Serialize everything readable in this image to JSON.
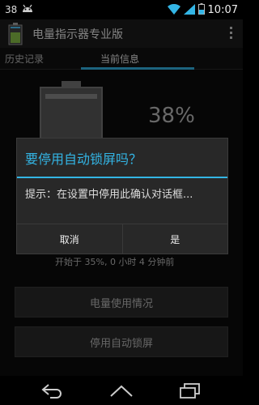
{
  "status_bar": {
    "battery_level_text": "38",
    "time": "10:07",
    "icons": [
      "android-debug-icon",
      "wifi-icon",
      "cell-signal-icon",
      "battery-icon"
    ]
  },
  "app": {
    "title": "电量指示器专业版"
  },
  "tabs": [
    {
      "label": "历史记录",
      "active": false
    },
    {
      "label": "当前信息",
      "active": true
    }
  ],
  "battery": {
    "percent_text": "38%",
    "level": 0.38
  },
  "info": {
    "since_text": "开始于 35%, 0 小时 4 分钟前"
  },
  "buttons": {
    "usage_label": "电量使用情况",
    "disable_lock_label": "停用自动锁屏"
  },
  "dialog": {
    "title": "要停用自动锁屏吗？",
    "message": "提示：在设置中停用此确认对话框...",
    "cancel_label": "取消",
    "confirm_label": "是"
  },
  "colors": {
    "accent": "#33b5e5",
    "battery_green": "#8bc34a"
  }
}
